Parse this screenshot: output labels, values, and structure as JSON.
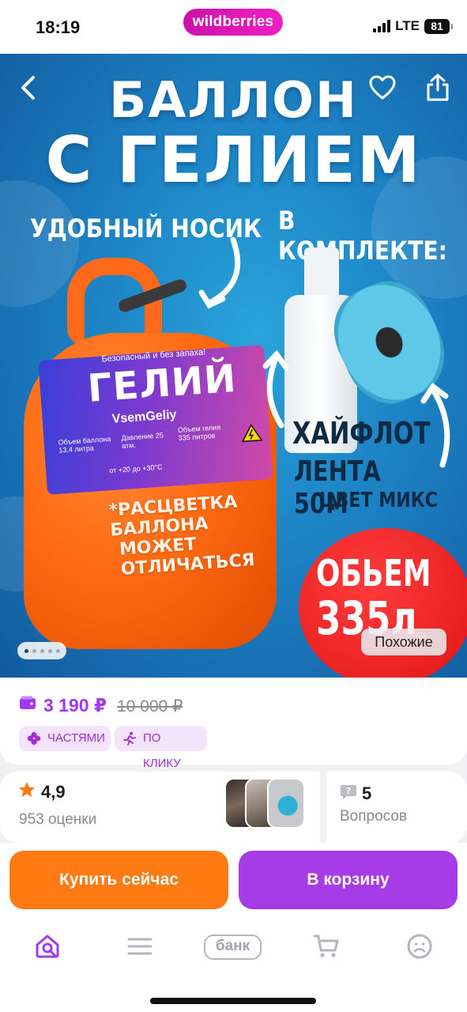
{
  "status_bar": {
    "time": "18:19",
    "app_logo_text": "wildberries",
    "network": "LTE",
    "battery": "81"
  },
  "product_image": {
    "title_line1": "БАЛЛОН",
    "title_line2": "С ГЕЛИЕМ",
    "caption_nozzle": "УДОБНЫЙ НОСИК",
    "caption_kit": "В КОМПЛЕКТЕ:",
    "cylinder_label": "ГЕЛИЙ",
    "cylinder_brand": "VsemGeliy",
    "cylinder_top_note": "Безопасный и без запаха!",
    "cylinder_spec1": "Объем баллона 13.4 литра",
    "cylinder_spec2": "Давление 25 атм.",
    "cylinder_spec3": "Объем гелия 335 литров",
    "cylinder_temp": "от +20 до +30°С",
    "color_note_line1": "*РАСЦВЕТКА БАЛЛОНА",
    "color_note_line2": "МОЖЕТ ОТЛИЧАТЬСЯ",
    "kit_item1": "ХАЙФЛОТ",
    "kit_item2": "ЛЕНТА 50М",
    "kit_item3": "ЦВЕТ МИКС",
    "volume_badge_line1": "ОБЬЕМ",
    "volume_badge_line2": "335л",
    "similar_label": "Похожие",
    "slide_count": 5,
    "active_slide": 1
  },
  "price": {
    "current": "3 190 ₽",
    "old": "10 000 ₽",
    "chip_parts": "ЧАСТЯМИ",
    "chip_one_click": "ПО КЛИКУ"
  },
  "rating": {
    "value": "4,9",
    "count_label": "953 оценки",
    "questions_count": "5",
    "questions_label": "Вопросов"
  },
  "actions": {
    "buy_now": "Купить сейчас",
    "add_to_cart": "В корзину"
  },
  "bottom_nav": {
    "bank_label": "банк"
  },
  "colors": {
    "brand_purple": "#a238f3",
    "buy_orange": "#ff7a12",
    "cart_purple": "#a63ce8",
    "logo_gradient_start": "#cb11ab"
  }
}
